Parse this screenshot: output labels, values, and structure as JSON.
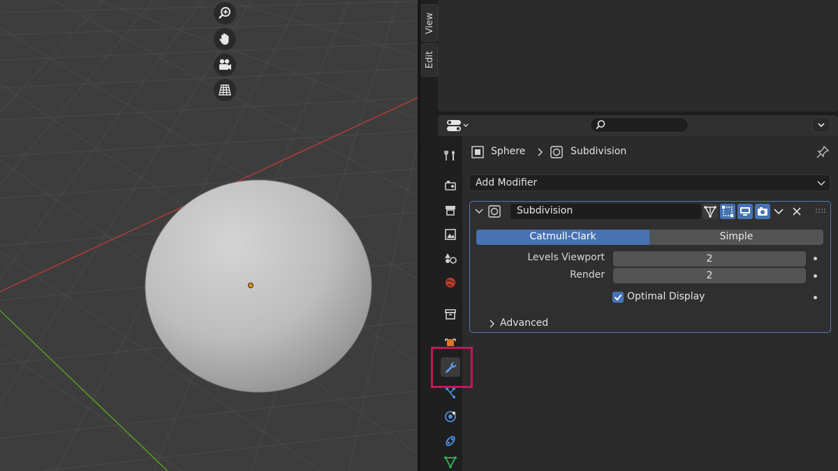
{
  "viewport": {
    "nav": [
      "zoom-icon",
      "pan-hand-icon",
      "camera-icon",
      "grid-icon"
    ]
  },
  "sidebar_tabs": {
    "view": "View",
    "edit": "Edit"
  },
  "breadcrumb": {
    "object": "Sphere",
    "modifier": "Subdivision"
  },
  "add_modifier": "Add Modifier",
  "modifier": {
    "name": "Subdivision",
    "algorithm_options": [
      "Catmull-Clark",
      "Simple"
    ],
    "selected_algorithm": "Catmull-Clark",
    "levels_viewport_label": "Levels Viewport",
    "levels_viewport_value": "2",
    "render_label": "Render",
    "render_value": "2",
    "optimal_display_label": "Optimal Display",
    "optimal_display_checked": true,
    "advanced_label": "Advanced"
  },
  "colors": {
    "accent": "#4772b3",
    "highlight": "#c2185b",
    "x_axis": "#b33b3b",
    "y_axis": "#5a9a23"
  }
}
